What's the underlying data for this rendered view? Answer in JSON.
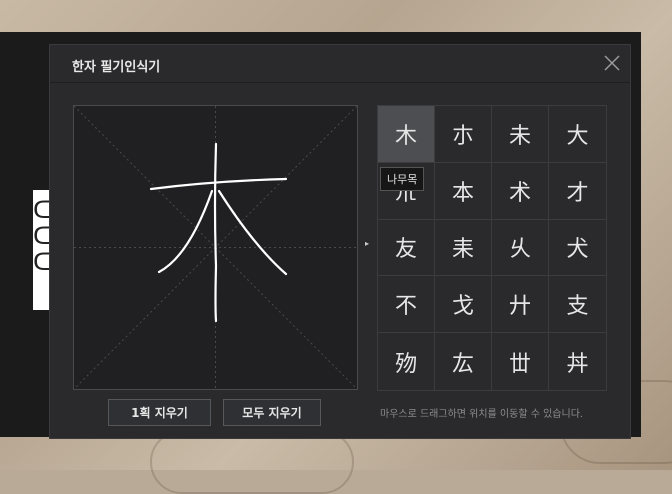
{
  "dialog": {
    "title": "한자 필기인식기",
    "hint": "마우스로 드래그하면 위치를 이동할 수 있습니다.",
    "clear_stroke_label": "1획 지우기",
    "clear_all_label": "모두 지우기",
    "arrow_glyph": "▸",
    "close_icon": "close-icon"
  },
  "tooltip": "나무목",
  "candidates": [
    "木",
    "朩",
    "未",
    "大",
    "朮",
    "本",
    "术",
    "才",
    "友",
    "耒",
    "乆",
    "犬",
    "不",
    "戈",
    "廾",
    "支",
    "歾",
    "厷",
    "丗",
    "丼"
  ],
  "colors": {
    "dialog_bg": "#2a2a2c",
    "canvas_bg": "#202022",
    "selected_cell": "#4c4e51",
    "stroke": "#ffffff"
  }
}
